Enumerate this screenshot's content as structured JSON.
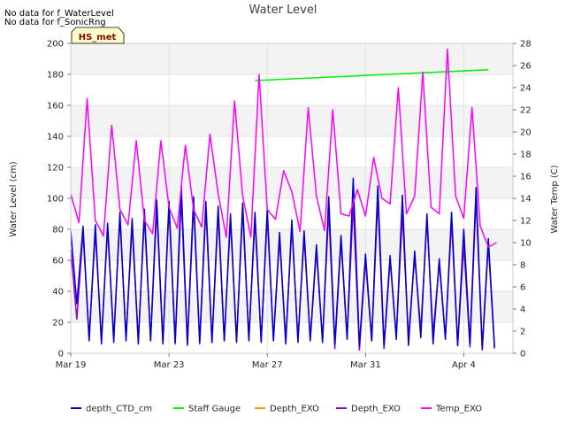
{
  "header": {
    "title": "Water Level",
    "notes": [
      "No data for f_WaterLevel",
      "No data for f_SonicRng"
    ],
    "badge": "HS_met"
  },
  "chart_data": {
    "type": "line",
    "title": "Water Level",
    "xlabel": "",
    "ylabel": "Water Level (cm)",
    "y2label": "Water Temp (C)",
    "xlim": [
      "2024-03-19",
      "2024-04-06"
    ],
    "ylim": [
      0,
      200
    ],
    "y2lim": [
      0,
      28
    ],
    "xticks": [
      {
        "date": "2024-03-19",
        "label": "Mar 19"
      },
      {
        "date": "2024-03-23",
        "label": "Mar 23"
      },
      {
        "date": "2024-03-27",
        "label": "Mar 27"
      },
      {
        "date": "2024-03-31",
        "label": "Mar 31"
      },
      {
        "date": "2024-04-04",
        "label": "Apr 4"
      }
    ],
    "yticks": [
      0,
      20,
      40,
      60,
      80,
      100,
      120,
      140,
      160,
      180,
      200
    ],
    "y2ticks": [
      0,
      2,
      4,
      6,
      8,
      10,
      12,
      14,
      16,
      18,
      20,
      22,
      24,
      26,
      28
    ],
    "grid": true,
    "legend_position": "bottom",
    "series": [
      {
        "name": "depth_CTD_cm",
        "color": "#0000cc",
        "axis": "left",
        "note": "tidal oscillation, about two cycles per day",
        "x": [
          "2024-03-19T00:00",
          "2024-03-19T06:00",
          "2024-03-19T12:00",
          "2024-03-19T18:00",
          "2024-03-20T00:00",
          "2024-03-20T06:00",
          "2024-03-20T12:00",
          "2024-03-20T18:00",
          "2024-03-21T00:00",
          "2024-03-21T06:00",
          "2024-03-21T12:00",
          "2024-03-21T18:00",
          "2024-03-22T00:00",
          "2024-03-22T06:00",
          "2024-03-22T12:00",
          "2024-03-22T18:00",
          "2024-03-23T00:00",
          "2024-03-23T06:00",
          "2024-03-23T12:00",
          "2024-03-23T18:00",
          "2024-03-24T00:00",
          "2024-03-24T06:00",
          "2024-03-24T12:00",
          "2024-03-24T18:00",
          "2024-03-25T00:00",
          "2024-03-25T06:00",
          "2024-03-25T12:00",
          "2024-03-25T18:00",
          "2024-03-26T00:00",
          "2024-03-26T06:00",
          "2024-03-26T12:00",
          "2024-03-26T18:00",
          "2024-03-27T00:00",
          "2024-03-27T06:00",
          "2024-03-27T12:00",
          "2024-03-27T18:00",
          "2024-03-28T00:00",
          "2024-03-28T06:00",
          "2024-03-28T12:00",
          "2024-03-28T18:00",
          "2024-03-29T00:00",
          "2024-03-29T06:00",
          "2024-03-29T12:00",
          "2024-03-29T18:00",
          "2024-03-30T00:00",
          "2024-03-30T06:00",
          "2024-03-30T12:00",
          "2024-03-30T18:00",
          "2024-03-31T00:00",
          "2024-03-31T06:00",
          "2024-03-31T12:00",
          "2024-03-31T18:00",
          "2024-04-01T00:00",
          "2024-04-01T06:00",
          "2024-04-01T12:00",
          "2024-04-01T18:00",
          "2024-04-02T00:00",
          "2024-04-02T06:00",
          "2024-04-02T12:00",
          "2024-04-02T18:00",
          "2024-04-03T00:00",
          "2024-04-03T06:00",
          "2024-04-03T12:00",
          "2024-04-03T18:00",
          "2024-04-04T00:00",
          "2024-04-04T06:00",
          "2024-04-04T12:00",
          "2024-04-04T18:00",
          "2024-04-05T00:00",
          "2024-04-05T06:00"
        ],
        "y": [
          79,
          32,
          82,
          8,
          83,
          6,
          84,
          7,
          91,
          8,
          87,
          6,
          93,
          8,
          99,
          6,
          98,
          7,
          108,
          6,
          101,
          7,
          98,
          7,
          95,
          8,
          90,
          7,
          97,
          8,
          91,
          7,
          93,
          8,
          78,
          6,
          86,
          7,
          79,
          8,
          70,
          7,
          101,
          6,
          76,
          9,
          113,
          5,
          64,
          8,
          108,
          5,
          63,
          9,
          102,
          5,
          66,
          10,
          90,
          6,
          61,
          9,
          91,
          5,
          80,
          6,
          107,
          3,
          74,
          4
        ]
      },
      {
        "name": "Staff Gauge",
        "color": "#00ee00",
        "axis": "left",
        "x": [
          "2024-03-26T12:00",
          "2024-04-05T00:00"
        ],
        "y": [
          176,
          183
        ]
      },
      {
        "name": "Depth_EXO",
        "color": "#ff9900",
        "axis": "left",
        "x": [],
        "y": []
      },
      {
        "name": "Depth_EXO",
        "color": "#9900cc",
        "axis": "left",
        "x": [
          "2024-03-19T00:00",
          "2024-03-19T06:00",
          "2024-03-19T12:00",
          "2024-03-19T18:00",
          "2024-03-20T00:00",
          "2024-03-20T06:00",
          "2024-03-20T12:00",
          "2024-03-20T18:00",
          "2024-03-21T00:00",
          "2024-03-21T06:00",
          "2024-03-21T12:00",
          "2024-03-21T18:00",
          "2024-03-22T00:00",
          "2024-03-22T06:00",
          "2024-03-22T12:00",
          "2024-03-22T18:00",
          "2024-03-23T00:00",
          "2024-03-23T06:00",
          "2024-03-23T12:00",
          "2024-03-23T18:00",
          "2024-03-24T00:00",
          "2024-03-24T06:00",
          "2024-03-24T12:00",
          "2024-03-24T18:00",
          "2024-03-25T00:00",
          "2024-03-25T06:00",
          "2024-03-25T12:00",
          "2024-03-25T18:00",
          "2024-03-26T00:00",
          "2024-03-26T06:00",
          "2024-03-26T12:00",
          "2024-03-26T18:00",
          "2024-03-27T00:00",
          "2024-03-27T06:00",
          "2024-03-27T12:00",
          "2024-03-27T18:00",
          "2024-03-28T00:00",
          "2024-03-28T06:00",
          "2024-03-28T12:00",
          "2024-03-28T18:00",
          "2024-03-29T00:00",
          "2024-03-29T06:00",
          "2024-03-29T12:00",
          "2024-03-29T18:00",
          "2024-03-30T00:00",
          "2024-03-30T06:00",
          "2024-03-30T12:00",
          "2024-03-30T18:00",
          "2024-03-31T00:00",
          "2024-03-31T06:00",
          "2024-03-31T12:00",
          "2024-03-31T18:00",
          "2024-04-01T00:00",
          "2024-04-01T06:00",
          "2024-04-01T12:00",
          "2024-04-01T18:00",
          "2024-04-02T00:00",
          "2024-04-02T06:00",
          "2024-04-02T12:00",
          "2024-04-02T18:00",
          "2024-04-03T00:00",
          "2024-04-03T06:00",
          "2024-04-03T12:00",
          "2024-04-03T18:00",
          "2024-04-04T00:00",
          "2024-04-04T06:00",
          "2024-04-04T12:00",
          "2024-04-04T18:00",
          "2024-04-05T00:00",
          "2024-04-05T06:00"
        ],
        "y": [
          67,
          22,
          78,
          10,
          78,
          9,
          80,
          10,
          87,
          10,
          82,
          8,
          88,
          9,
          93,
          7,
          94,
          6,
          100,
          5,
          96,
          6,
          93,
          7,
          90,
          8,
          86,
          8,
          92,
          9,
          86,
          8,
          88,
          9,
          74,
          8,
          82,
          9,
          75,
          9,
          66,
          8,
          92,
          3,
          72,
          10,
          96,
          2,
          60,
          8,
          99,
          3,
          60,
          11,
          90,
          10,
          62,
          15,
          86,
          12,
          58,
          10,
          85,
          5,
          70,
          4,
          100,
          2,
          70,
          3
        ]
      },
      {
        "name": "Temp_EXO",
        "color": "#ff00ff",
        "axis": "right",
        "note": "daily temperature cycle, values in degrees C",
        "x": [
          "2024-03-19T00:00",
          "2024-03-19T08:00",
          "2024-03-19T16:00",
          "2024-03-20T00:00",
          "2024-03-20T08:00",
          "2024-03-20T16:00",
          "2024-03-21T00:00",
          "2024-03-21T08:00",
          "2024-03-21T16:00",
          "2024-03-22T00:00",
          "2024-03-22T08:00",
          "2024-03-22T16:00",
          "2024-03-23T00:00",
          "2024-03-23T08:00",
          "2024-03-23T16:00",
          "2024-03-24T00:00",
          "2024-03-24T08:00",
          "2024-03-24T16:00",
          "2024-03-25T00:00",
          "2024-03-25T08:00",
          "2024-03-25T16:00",
          "2024-03-26T00:00",
          "2024-03-26T08:00",
          "2024-03-26T16:00",
          "2024-03-27T00:00",
          "2024-03-27T08:00",
          "2024-03-27T16:00",
          "2024-03-28T00:00",
          "2024-03-28T08:00",
          "2024-03-28T16:00",
          "2024-03-29T00:00",
          "2024-03-29T08:00",
          "2024-03-29T16:00",
          "2024-03-30T00:00",
          "2024-03-30T08:00",
          "2024-03-30T16:00",
          "2024-03-31T00:00",
          "2024-03-31T08:00",
          "2024-03-31T16:00",
          "2024-04-01T00:00",
          "2024-04-01T08:00",
          "2024-04-01T16:00",
          "2024-04-02T00:00",
          "2024-04-02T08:00",
          "2024-04-02T16:00",
          "2024-04-03T00:00",
          "2024-04-03T08:00",
          "2024-04-03T16:00",
          "2024-04-04T00:00",
          "2024-04-04T08:00",
          "2024-04-04T16:00",
          "2024-04-05T00:00",
          "2024-04-05T08:00"
        ],
        "y": [
          14.4,
          11.8,
          23.0,
          12.0,
          10.6,
          20.6,
          13.0,
          11.6,
          19.2,
          12.0,
          10.8,
          19.2,
          13.2,
          11.3,
          18.8,
          13.0,
          11.4,
          19.8,
          14.4,
          10.5,
          22.8,
          14.2,
          10.5,
          25.2,
          13.0,
          12.1,
          16.5,
          14.6,
          11.0,
          22.2,
          14.2,
          11.1,
          22.0,
          12.6,
          12.4,
          14.8,
          12.4,
          17.7,
          14.0,
          13.5,
          24.0,
          12.6,
          14.2,
          25.4,
          13.2,
          12.6,
          27.5,
          14.2,
          12.2,
          22.2,
          11.5,
          9.6,
          10.0
        ]
      }
    ]
  }
}
